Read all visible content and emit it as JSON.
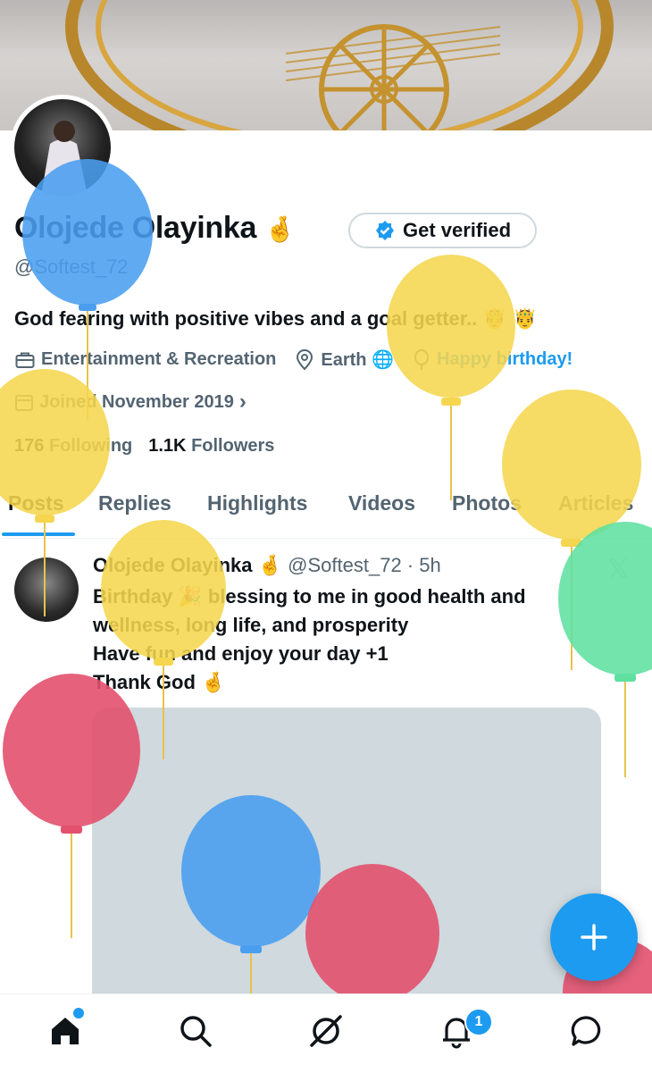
{
  "profile": {
    "display_name": "Olojede Olayinka",
    "name_emoji": "🤞",
    "handle": "@Softest_72",
    "bio": "God fearing with positive vibes and a goal getter.. 🤴 🤴",
    "verify_button": "Get verified",
    "category": "Entertainment & Recreation",
    "location": "Earth 🌐",
    "birthday": "Happy birthday!",
    "joined": "Joined November 2019",
    "following_count": "176",
    "following_label": "Following",
    "followers_count": "1.1K",
    "followers_label": "Followers"
  },
  "tabs": [
    "Posts",
    "Replies",
    "Highlights",
    "Videos",
    "Photos",
    "Articles"
  ],
  "post": {
    "name": "Olojede Olayinka",
    "name_emoji": "🤞",
    "handle_time": "@Softest_72 · 5h",
    "line1": "Birthday 🎉 blessing to me in good health and",
    "line2": "wellness, long life, and prosperity",
    "line3": "Have fun and enjoy your day +1",
    "line4": "Thank God 🤞"
  },
  "nav": {
    "notifications_count": "1"
  },
  "colors": {
    "accent": "#1d9bf0",
    "balloon_yellow": "#f5d64e",
    "balloon_blue": "#4a9ef0",
    "balloon_red": "#e2506e",
    "balloon_green": "#5fe0a0"
  }
}
